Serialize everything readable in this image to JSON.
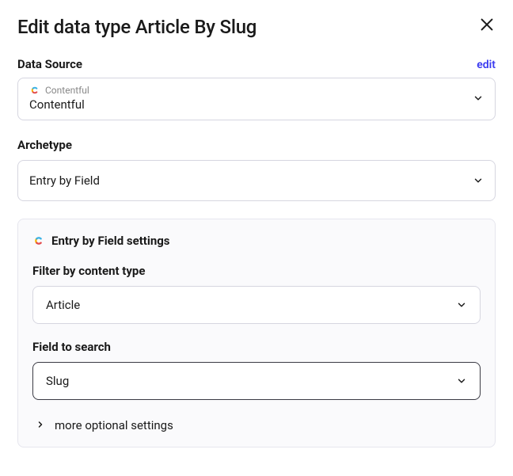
{
  "header": {
    "title": "Edit data type Article By Slug"
  },
  "dataSource": {
    "label": "Data Source",
    "editLabel": "edit",
    "providerName": "Contentful",
    "value": "Contentful"
  },
  "archetype": {
    "label": "Archetype",
    "value": "Entry by Field"
  },
  "settings": {
    "title": "Entry by Field settings",
    "filterByContentType": {
      "label": "Filter by content type",
      "value": "Article"
    },
    "fieldToSearch": {
      "label": "Field to search",
      "value": "Slug"
    },
    "moreLabel": "more optional settings"
  }
}
